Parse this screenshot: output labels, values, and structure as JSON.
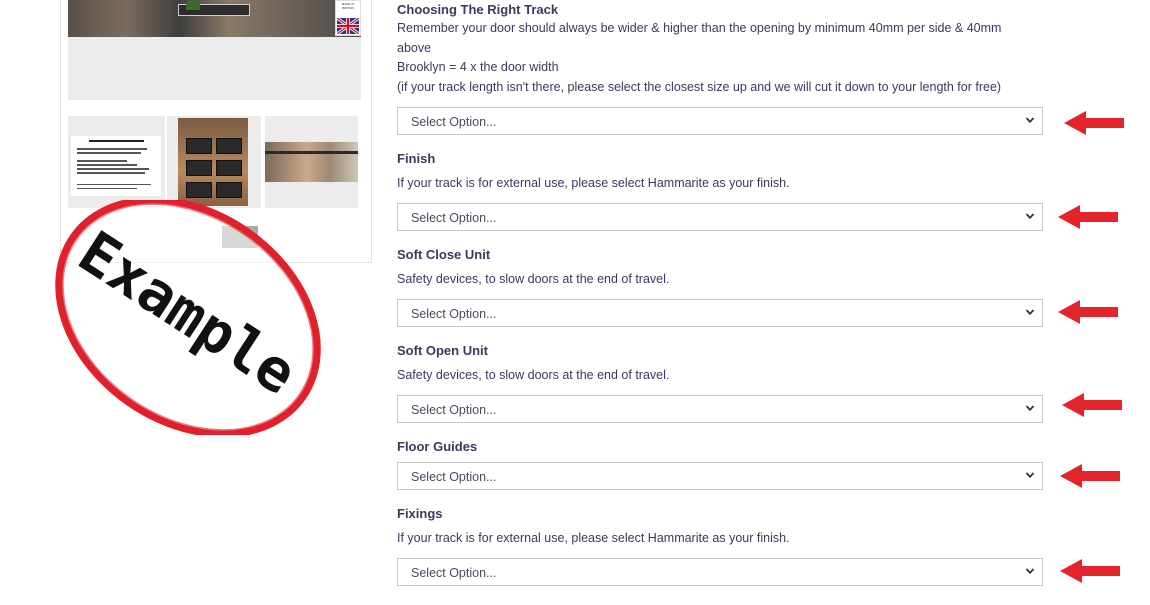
{
  "gallery": {
    "badge_text": "MADE IN BRITAIN",
    "stamp_text": "Example",
    "thumb_doc_title": "Ordering The Right Track Size!"
  },
  "options": [
    {
      "heading": "Choosing The Right Track",
      "description_lines": [
        "Remember your door should always be wider & higher than the opening by minimum 40mm per side & 40mm",
        "above",
        "Brooklyn = 4 x the door width",
        "(if your track length isn't there, please select the closest size up and we will cut it down to your length for free)"
      ],
      "select_value": "Select Option..."
    },
    {
      "heading": "Finish",
      "description_lines": [
        "If your track is for external use, please select Hammarite as your finish."
      ],
      "select_value": "Select Option..."
    },
    {
      "heading": "Soft Close Unit",
      "description_lines": [
        "Safety devices, to slow doors at the end of travel."
      ],
      "select_value": "Select Option..."
    },
    {
      "heading": "Soft Open Unit",
      "description_lines": [
        "Safety devices, to slow doors at the end of travel."
      ],
      "select_value": "Select Option..."
    },
    {
      "heading": "Floor Guides",
      "description_lines": [],
      "select_value": "Select Option..."
    },
    {
      "heading": "Fixings",
      "description_lines": [
        "If your track is for external use, please select Hammarite as your finish."
      ],
      "select_value": "Select Option..."
    }
  ],
  "colors": {
    "text": "#3a3a5c",
    "arrow": "#e3242b",
    "stamp": "#e0202a",
    "select_border": "#c9c9c9"
  },
  "icons": {
    "select_chevron": "chevron-down-icon",
    "annotation": "red-arrow-left-icon",
    "badge_flag": "union-flag-icon"
  }
}
